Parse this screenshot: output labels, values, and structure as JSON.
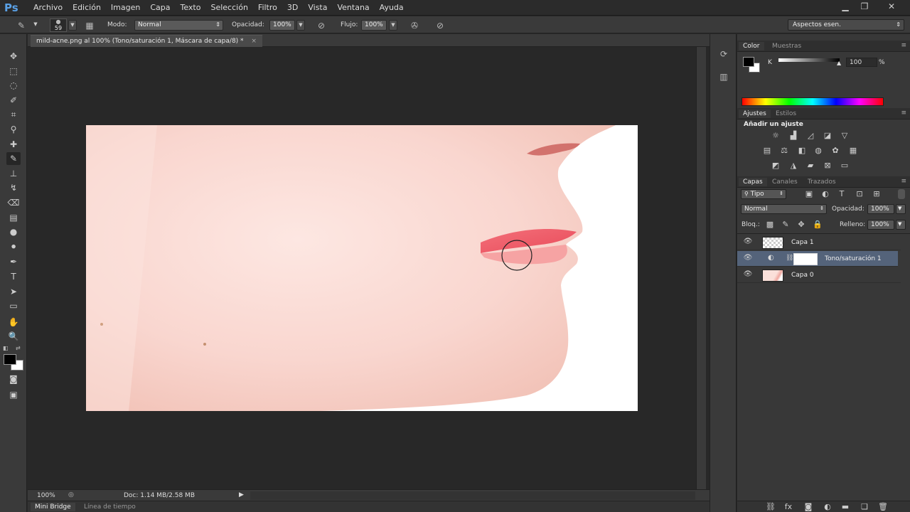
{
  "app": {
    "logo": "Ps"
  },
  "menu": [
    "Archivo",
    "Edición",
    "Imagen",
    "Capa",
    "Texto",
    "Selección",
    "Filtro",
    "3D",
    "Vista",
    "Ventana",
    "Ayuda"
  ],
  "window_controls": {
    "minimize": "▁",
    "restore": "❐",
    "close": "✕"
  },
  "options": {
    "brush_size": "59",
    "mode_label": "Modo:",
    "mode_value": "Normal",
    "opacity_label": "Opacidad:",
    "opacity_value": "100%",
    "flow_label": "Flujo:",
    "flow_value": "100%",
    "workspace": "Aspectos esen."
  },
  "document": {
    "tab_title": "mild-acne.png al 100% (Tono/saturación 1, Máscara de capa/8) *",
    "close": "×"
  },
  "status": {
    "zoom": "100%",
    "doc_info": "Doc: 1.14 MB/2.58 MB",
    "play": "▶"
  },
  "bottom_tabs": [
    "Mini Bridge",
    "Línea de tiempo"
  ],
  "color_panel": {
    "tabs": [
      "Color",
      "Muestras"
    ],
    "channel_label": "K",
    "channel_value": "100",
    "unit": "%"
  },
  "adjustments_panel": {
    "tabs": [
      "Ajustes",
      "Estilos"
    ],
    "heading": "Añadir un ajuste"
  },
  "layers_panel": {
    "tabs": [
      "Capas",
      "Canales",
      "Trazados"
    ],
    "filter_label": "Tipo",
    "blend_mode": "Normal",
    "opacity_label": "Opacidad:",
    "opacity_value": "100%",
    "lock_label": "Bloq.:",
    "fill_label": "Relleno:",
    "fill_value": "100%",
    "layers": [
      {
        "name": "Capa 1"
      },
      {
        "name": "Tono/saturación 1"
      },
      {
        "name": "Capa 0"
      }
    ]
  },
  "colors": {
    "accent": "#5aa1e6",
    "selected_layer": "#54637a",
    "foreground": "#000000",
    "background": "#ffffff"
  }
}
